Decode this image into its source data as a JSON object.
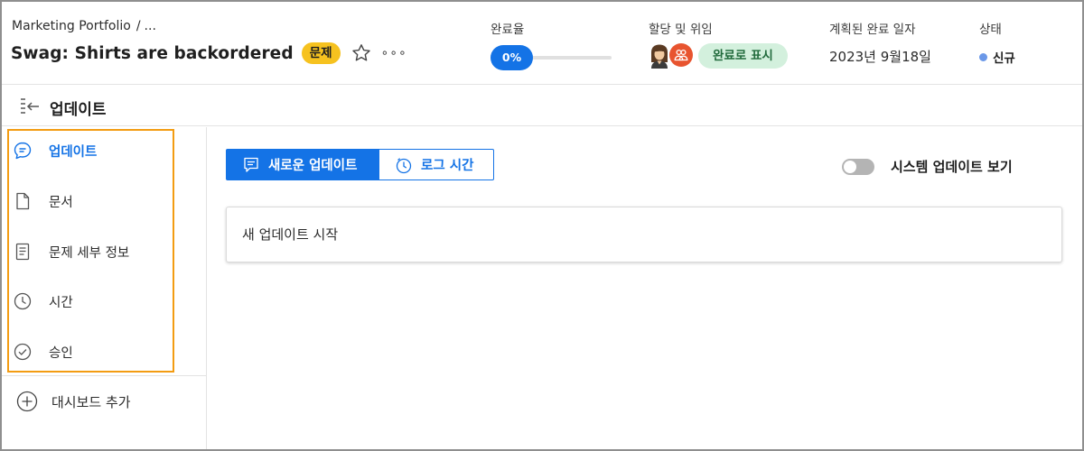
{
  "header": {
    "breadcrumb": {
      "project": "Marketing Portfolio",
      "separator": "/",
      "ellipsis": "..."
    },
    "title": "Swag: Shirts are backordered",
    "badge": "문제",
    "more_label": "∘∘∘",
    "progress": {
      "label": "완료율",
      "value_text": "0%",
      "value": 0
    },
    "assign": {
      "label": "할당 및 위임",
      "mark_done": "완료로 표시"
    },
    "due": {
      "label": "계획된 완료 일자",
      "value": "2023년 9월18일"
    },
    "status": {
      "label": "상태",
      "value": "신규",
      "dot_color": "#6b98e8"
    }
  },
  "section": {
    "title": "업데이트"
  },
  "sidebar": {
    "items": [
      {
        "label": "업데이트",
        "icon": "chat-bubble-icon",
        "active": true
      },
      {
        "label": "문서",
        "icon": "document-icon",
        "active": false
      },
      {
        "label": "문제 세부 정보",
        "icon": "details-icon",
        "active": false
      },
      {
        "label": "시간",
        "icon": "clock-icon",
        "active": false
      },
      {
        "label": "승인",
        "icon": "check-circle-icon",
        "active": false
      }
    ],
    "add_dashboard": "대시보드 추가"
  },
  "main": {
    "new_update_button": "새로운 업데이트",
    "log_time_button": "로그 시간",
    "system_updates_toggle": "시스템 업데이트 보기",
    "system_updates_on": false,
    "update_placeholder": "새 업데이트 시작"
  },
  "colors": {
    "accent": "#1473e6",
    "badge": "#f6c21f",
    "highlight_box": "#f39c12",
    "mark_done_bg": "#d3f0dd"
  }
}
